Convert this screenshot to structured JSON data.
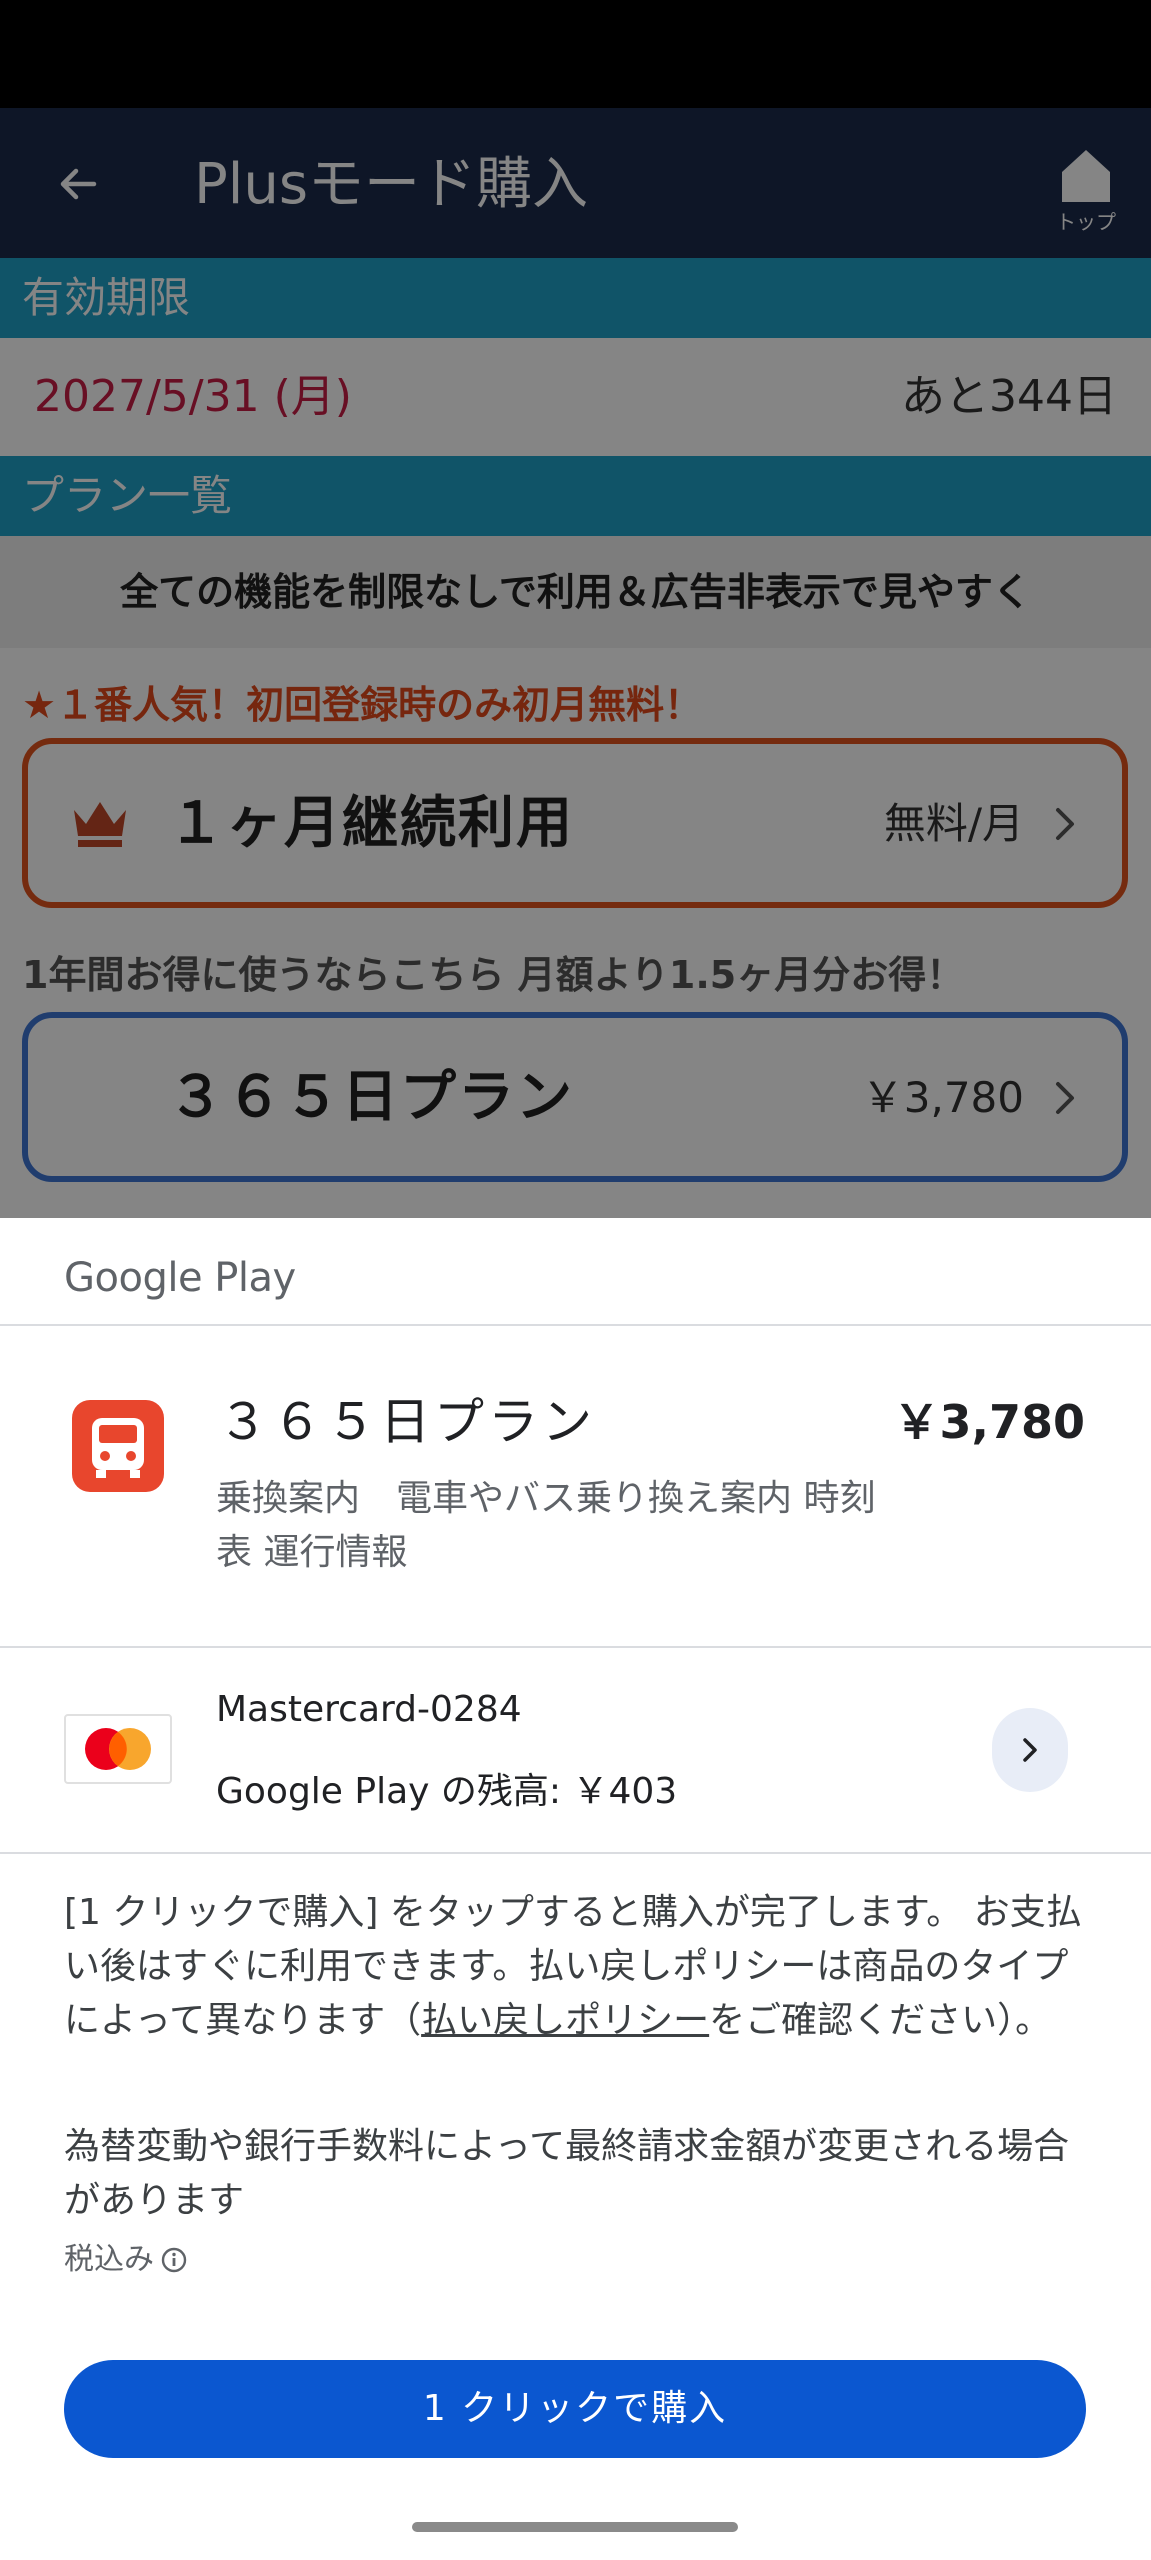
{
  "app": {
    "title": "Plusモード購入",
    "home_label": "トップ",
    "expiry_header": "有効期限",
    "expiry_date": "2027/5/31 (月)",
    "expiry_remaining": "あと344日",
    "plans_header": "プラン一覧",
    "tagline": "全ての機能を制限なしで利用＆広告非表示で見やすく",
    "promo_note": "★１番人気！初回登録時のみ初月無料！",
    "monthly_plan": {
      "name": "１ヶ月継続利用",
      "price": "無料/月"
    },
    "yearly_note": "1年間お得に使うならこちら 月額より1.5ヶ月分お得！",
    "yearly_plan": {
      "name": "３６５日プラン",
      "price": "￥3,780"
    },
    "colors": {
      "app_bar": "#1b2b4b",
      "section_header": "#1fa2c8",
      "date_red": "#c81e46",
      "monthly_border": "#e0541e",
      "yearly_border": "#3f76d4"
    }
  },
  "sheet": {
    "brand": "Google Play",
    "item": {
      "title": "３６５日プラン",
      "price": "￥3,780",
      "description": "乗換案内　電車やバス乗り換え案内 時刻表 運行情報"
    },
    "payment": {
      "card_name": "Mastercard-0284",
      "balance": "Google Play の残高: ￥403"
    },
    "terms_before": "[1 クリックで購入] をタップすると購入が完了します。 お支払い後はすぐに利用できます。払い戻しポリシーは商品のタイプによって異なります（",
    "terms_link": "払い戻しポリシー",
    "terms_after": "をご確認ください）。",
    "fx_note": "為替変動や銀行手数料によって最終請求金額が変更される場合があります",
    "tax_label": "税込み",
    "buy_button": "1 クリックで購入",
    "colors": {
      "button": "#0b57d0",
      "app_icon": "#e8462d"
    }
  },
  "icons": [
    "back-arrow-icon",
    "home-icon",
    "crown-icon",
    "chevron-right-icon",
    "train-app-icon",
    "mastercard-icon",
    "info-icon"
  ]
}
